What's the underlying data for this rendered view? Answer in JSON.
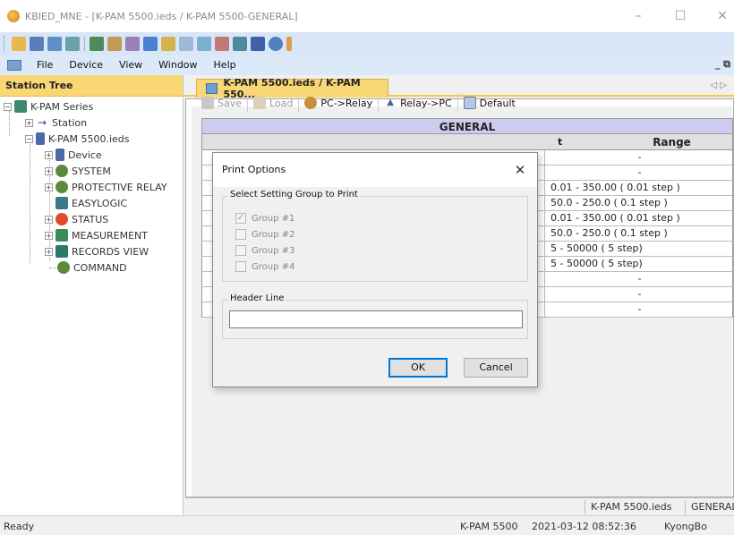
{
  "window": {
    "title": "KBIED_MNE - [K-PAM 5500.ieds / K-PAM 5500-GENERAL]",
    "minimize": "–",
    "maximize": "☐",
    "close": "✕"
  },
  "menu": {
    "items": [
      "File",
      "Device",
      "View",
      "Window",
      "Help"
    ],
    "mdi_controls": "_ ⧉"
  },
  "tree": {
    "header": "Station Tree",
    "nodes": [
      {
        "label": "K-PAM Series",
        "icon": "station-series-icon"
      },
      {
        "label": "Station",
        "icon": "arrow-right-icon"
      },
      {
        "label": "K-PAM 5500.ieds",
        "icon": "ieds-file-icon"
      },
      {
        "label": "Device",
        "icon": "device-icon"
      },
      {
        "label": "SYSTEM",
        "icon": "gears-icon"
      },
      {
        "label": "PROTECTIVE RELAY",
        "icon": "gears-icon"
      },
      {
        "label": "EASYLOGIC",
        "icon": "logic-icon"
      },
      {
        "label": "STATUS",
        "icon": "status-icon"
      },
      {
        "label": "MEASUREMENT",
        "icon": "measurement-icon"
      },
      {
        "label": "RECORDS VIEW",
        "icon": "records-icon"
      },
      {
        "label": "COMMAND",
        "icon": "gears-icon"
      }
    ]
  },
  "document": {
    "tab_label": "K-PAM 5500.ieds / K-PAM 550...",
    "tab_nav": "◁ ▷",
    "actions": {
      "save": "Save",
      "load": "Load",
      "pc_to_relay": "PC->Relay",
      "relay_to_pc": "Relay->PC",
      "default": "Default"
    },
    "table": {
      "title": "GENERAL",
      "range_header": "Range",
      "col_hint": "t",
      "rows": [
        "-",
        "-",
        "0.01 - 350.00 ( 0.01 step )",
        "50.0 - 250.0 ( 0.1 step )",
        "0.01 - 350.00 ( 0.01 step )",
        "50.0 - 250.0 ( 0.1 step )",
        "5 - 50000 ( 5 step)",
        "5 - 50000 ( 5 step)",
        "-",
        "-",
        "-"
      ]
    },
    "footer": {
      "file": "K-PAM 5500.ieds",
      "section": "GENERAL"
    }
  },
  "dialog": {
    "title": "Print Options",
    "close": "✕",
    "group_label": "Select Setting Group to Print",
    "groups": [
      {
        "label": "Group #1",
        "checked": true
      },
      {
        "label": "Group #2",
        "checked": false
      },
      {
        "label": "Group #3",
        "checked": false
      },
      {
        "label": "Group #4",
        "checked": false
      }
    ],
    "header_line_label": "Header Line",
    "header_line_value": "",
    "ok": "OK",
    "cancel": "Cancel"
  },
  "status": {
    "left": "Ready",
    "device": "K-PAM 5500",
    "datetime": "2021-03-12 08:52:36",
    "user": "KyongBo"
  }
}
